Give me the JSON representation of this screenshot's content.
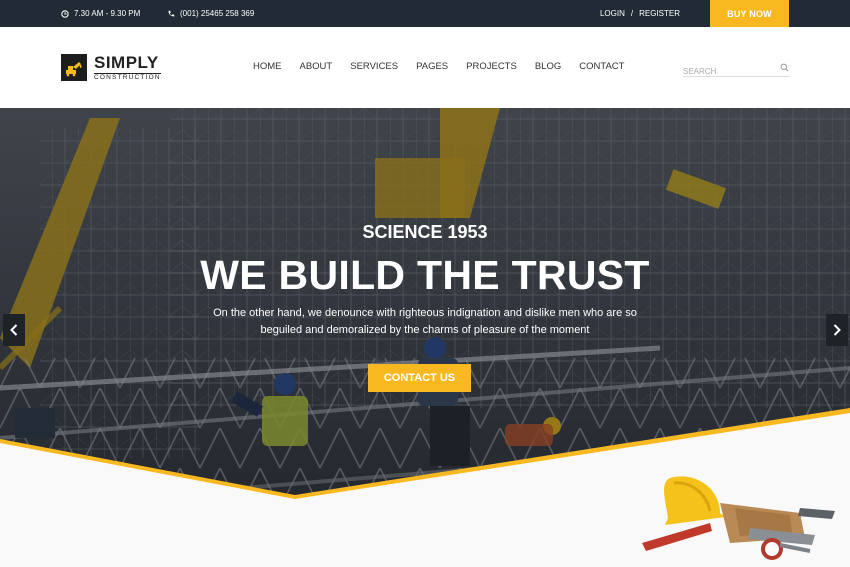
{
  "topbar": {
    "hours": "7.30 AM - 9.30 PM",
    "phone": "(001) 25465 258 369",
    "login": "LOGIN",
    "separator": "/",
    "register": "REGISTER",
    "buy_now": "BUY NOW"
  },
  "logo": {
    "name": "SIMPLY",
    "tagline": "CONSTRUCTION"
  },
  "nav": {
    "items": [
      "HOME",
      "ABOUT",
      "SERVICES",
      "PAGES",
      "PROJECTS",
      "BLOG",
      "CONTACT"
    ]
  },
  "search": {
    "placeholder": "SEARCH"
  },
  "hero": {
    "subtitle": "SCIENCE 1953",
    "title": "WE BUILD THE TRUST",
    "text_line1": "On the other hand, we denounce with righteous indignation and dislike men who are so",
    "text_line2": "beguiled and demoralized by the charms of pleasure of the moment",
    "cta": "CONTACT US"
  },
  "colors": {
    "accent": "#f8b81f",
    "topbar": "#222b35",
    "dark": "#1d1d1d"
  },
  "icons": {
    "hours": "clock-icon",
    "phone": "phone-icon",
    "search": "search-icon",
    "prev": "chevron-left-icon",
    "next": "chevron-right-icon",
    "logo": "excavator-icon"
  }
}
